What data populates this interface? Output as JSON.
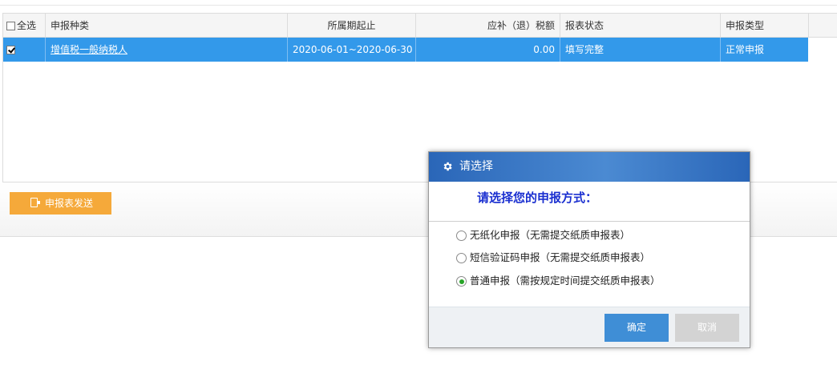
{
  "table": {
    "select_all_label": "全选",
    "headers": {
      "category": "申报种类",
      "period": "所属期起止",
      "tax_amount": "应补（退）税额",
      "report_status": "报表状态",
      "declaration_type": "申报类型"
    },
    "rows": [
      {
        "checked": true,
        "category": "增值税一般纳税人",
        "period": "2020-06-01~2020-06-30",
        "tax_amount": "0.00",
        "report_status": "填写完整",
        "declaration_type": "正常申报"
      }
    ]
  },
  "toolbar": {
    "send_label": "申报表发送",
    "send_icon": "document-icon"
  },
  "dialog": {
    "title": "请选择",
    "title_icon": "gear-icon",
    "prompt": "请选择您的申报方式：",
    "options": [
      {
        "label": "无纸化申报（无需提交纸质申报表）",
        "selected": false
      },
      {
        "label": "短信验证码申报（无需提交纸质申报表）",
        "selected": false
      },
      {
        "label": "普通申报（需按规定时间提交纸质申报表）",
        "selected": true
      }
    ],
    "ok_label": "确定",
    "cancel_label": "取消"
  },
  "colors": {
    "selected_row": "#3399ea",
    "send_button": "#f5a93a",
    "dialog_title": "#2a66b8",
    "prompt_text": "#1a2fd0",
    "ok_button": "#3f8ed6",
    "cancel_button": "#d3d3d3",
    "radio_selected": "#27a427"
  }
}
